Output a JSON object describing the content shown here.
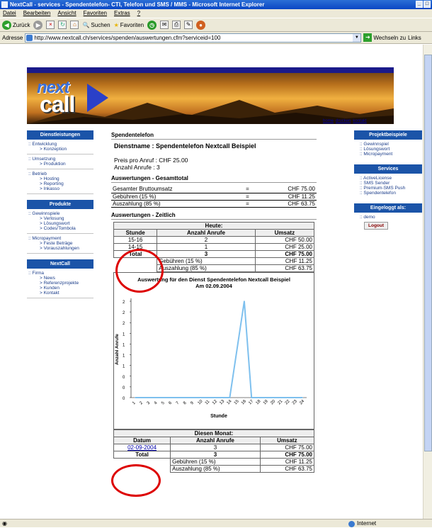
{
  "window": {
    "title": "NextCall - services - Spendentelefon- CTI, Telefon und SMS / MMS - Microsoft Internet Explorer"
  },
  "menu": [
    "Datei",
    "Bearbeiten",
    "Ansicht",
    "Favoriten",
    "Extras",
    "?"
  ],
  "toolbar": {
    "back": "Zurück",
    "search": "Suchen",
    "favorites": "Favoriten"
  },
  "address": {
    "label": "Adresse",
    "url": "http://www.nextcall.ch/services/spenden/auswertungen.cfm?serviceid=100",
    "go": "Wechseln zu",
    "links": "Links"
  },
  "status": {
    "zone": "Internet"
  },
  "logo": {
    "next": "next",
    "call": "call"
  },
  "toplinks": [
    "home",
    "drucken",
    "kontakt"
  ],
  "left": {
    "head1": "Dienstleistungen",
    "g1": [
      [
        ":: Entwicklung",
        "> Konzeption"
      ],
      [
        ":: Umsetzung",
        "> Produktion"
      ],
      [
        ":: Betrieb",
        "> Hosting",
        "> Reporting",
        "> Inkasso"
      ]
    ],
    "head2": "Produkte",
    "g2": [
      [
        ":: Gewinnspiele",
        "> Verlosung",
        "> Lösungswort",
        "> Codes/Tombola"
      ],
      [
        ":: Micropayment",
        "> Feste Beträge",
        "> Vorauszahlungen"
      ]
    ],
    "head3": "NextCall",
    "g3": [
      [
        ":: Firma",
        "> News",
        "> Referenzprojekte",
        "> Kunden",
        "> Kontakt"
      ]
    ]
  },
  "right": {
    "head1": "Projektbeispiele",
    "items1": [
      ":: Gewinnspiel",
      ":: Lösungswort",
      ":: Micropayment"
    ],
    "head2": "Services",
    "items2": [
      ":: ActiveLicense",
      ":: SMS Sender",
      ":: Premium-SMS Push",
      ":: Spendentelefon"
    ],
    "head3": "Eingeloggt als:",
    "user": ":: demo",
    "logout": "Logout"
  },
  "main": {
    "section1": "Spendentelefon",
    "dienstname": "Dienstname : Spendentelefon Nextcall Beispiel",
    "preis": "Preis pro Anruf : CHF 25.00",
    "anrufe": "Anzahl Anrufe : 3",
    "section2": "Auswertungen - Gesamttotal",
    "totals": [
      {
        "label": "Gesamter Bruttoumsatz",
        "eq": "=",
        "value": "CHF 75.00"
      },
      {
        "label": "Gebühren (15 %)",
        "eq": "=",
        "value": "CHF 11.25"
      },
      {
        "label": "Auszahlung (85 %)",
        "eq": "=",
        "value": "CHF 63.75"
      }
    ],
    "section3": "Auswertungen - Zeitlich",
    "today": {
      "caption": "Heute:",
      "headers": [
        "Stunde",
        "Anzahl Anrufe",
        "Umsatz"
      ],
      "rows": [
        [
          "15-16",
          "2",
          "CHF 50.00"
        ],
        [
          "14-15",
          "1",
          "CHF 25.00"
        ]
      ],
      "total": [
        "Total",
        "3",
        "CHF 75.00"
      ],
      "fees": [
        "Gebühren (15 %)",
        "CHF 11.25"
      ],
      "payout": [
        "Auszahlung (85 %)",
        "CHF 63.75"
      ]
    },
    "month": {
      "caption": "Diesen Monat:",
      "headers": [
        "Datum",
        "Anzahl Anrufe",
        "Umsatz"
      ],
      "rows": [
        [
          "02-09-2004",
          "3",
          "CHF 75.00"
        ]
      ],
      "total": [
        "Total",
        "3",
        "CHF 75.00"
      ],
      "fees": [
        "Gebühren (15 %)",
        "CHF 11.25"
      ],
      "payout": [
        "Auszahlung (85 %)",
        "CHF 63.75"
      ]
    }
  },
  "chart_data": {
    "type": "line",
    "title": "Auswertung für den Dienst Spendentelefon Nextcall Beispiel",
    "subtitle": "Am 02.09.2004",
    "xlabel": "Stunde",
    "ylabel": "Anzahl Anrufe",
    "x": [
      1,
      2,
      3,
      4,
      5,
      6,
      7,
      8,
      9,
      10,
      11,
      12,
      13,
      14,
      15,
      16,
      17,
      18,
      19,
      20,
      21,
      22,
      23,
      24
    ],
    "values": [
      0,
      0,
      0,
      0,
      0,
      0,
      0,
      0,
      0,
      0,
      0,
      0,
      0,
      0,
      1,
      2,
      0,
      0,
      0,
      0,
      0,
      0,
      0,
      0
    ],
    "yticks": [
      "2",
      "2",
      "2",
      "1",
      "1",
      "1",
      "1",
      "0",
      "0",
      "0"
    ],
    "ylim": [
      0,
      2
    ],
    "color": "#7ec0ee"
  }
}
